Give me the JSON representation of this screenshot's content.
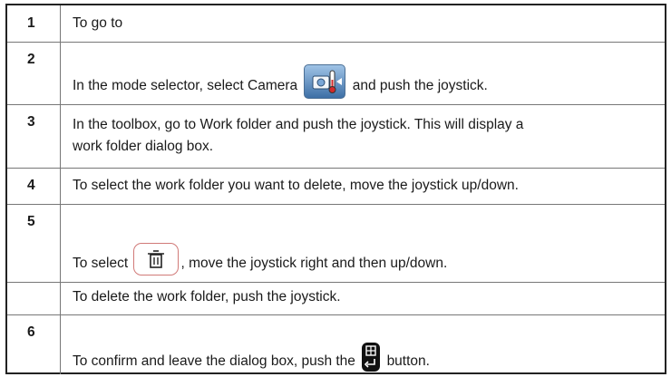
{
  "rows": [
    {
      "num": "1",
      "text": "To go to"
    },
    {
      "num": "2",
      "before": "In the mode selector, select",
      "bold": "Camera",
      "after": "and push the joystick.",
      "icon": "camera-mode-icon"
    },
    {
      "num": "3",
      "before": "In the toolbox, go to",
      "bold": "Work folder",
      "after": "and push the joystick. This will display a",
      "line2": "work folder dialog box."
    },
    {
      "num": "4",
      "text": "To select the work folder you want to delete, move the joystick up/down."
    },
    {
      "num": "5",
      "before": "To select",
      "after": ", move the joystick right and then up/down.",
      "icon": "trash-icon"
    },
    {
      "num": "",
      "text": "To delete the work folder, push the joystick."
    },
    {
      "num": "6",
      "before": "To confirm and leave the dialog box, push the",
      "after": "button.",
      "icon": "joystick-button-icon"
    }
  ]
}
